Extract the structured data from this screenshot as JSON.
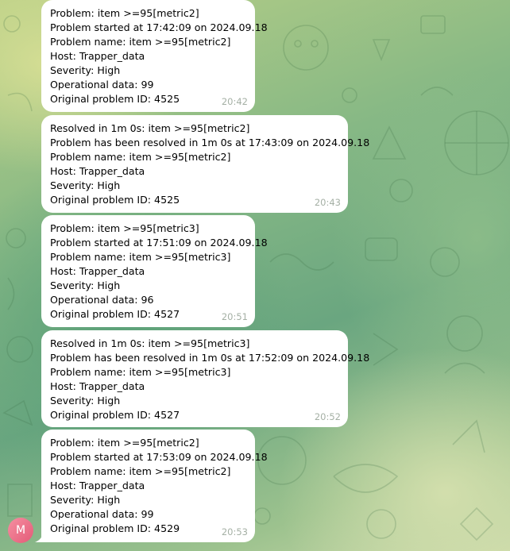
{
  "sender": {
    "avatar_initial": "M"
  },
  "messages": [
    {
      "lines": [
        "Problem: item >=95[metric2]",
        "Problem started at 17:42:09 on 2024.09.18",
        "Problem name: item >=95[metric2]",
        "Host: Trapper_data",
        "Severity: High",
        "Operational data: 99",
        "Original problem ID: 4525"
      ],
      "time": "20:42"
    },
    {
      "lines": [
        "Resolved in 1m 0s: item >=95[metric2]",
        "Problem has been resolved in 1m 0s at 17:43:09 on 2024.09.18",
        "Problem name: item >=95[metric2]",
        "Host: Trapper_data",
        "Severity: High",
        "Original problem ID: 4525"
      ],
      "time": "20:43"
    },
    {
      "lines": [
        "Problem: item >=95[metric3]",
        "Problem started at 17:51:09 on 2024.09.18",
        "Problem name: item >=95[metric3]",
        "Host: Trapper_data",
        "Severity: High",
        "Operational data: 96",
        "Original problem ID: 4527"
      ],
      "time": "20:51"
    },
    {
      "lines": [
        "Resolved in 1m 0s: item >=95[metric3]",
        "Problem has been resolved in 1m 0s at 17:52:09 on 2024.09.18",
        "Problem name: item >=95[metric3]",
        "Host: Trapper_data",
        "Severity: High",
        "Original problem ID: 4527"
      ],
      "time": "20:52"
    },
    {
      "lines": [
        "Problem: item >=95[metric2]",
        "Problem started at 17:53:09 on 2024.09.18",
        "Problem name: item >=95[metric2]",
        "Host: Trapper_data",
        "Severity: High",
        "Operational data: 99",
        "Original problem ID: 4529"
      ],
      "time": "20:53"
    }
  ]
}
